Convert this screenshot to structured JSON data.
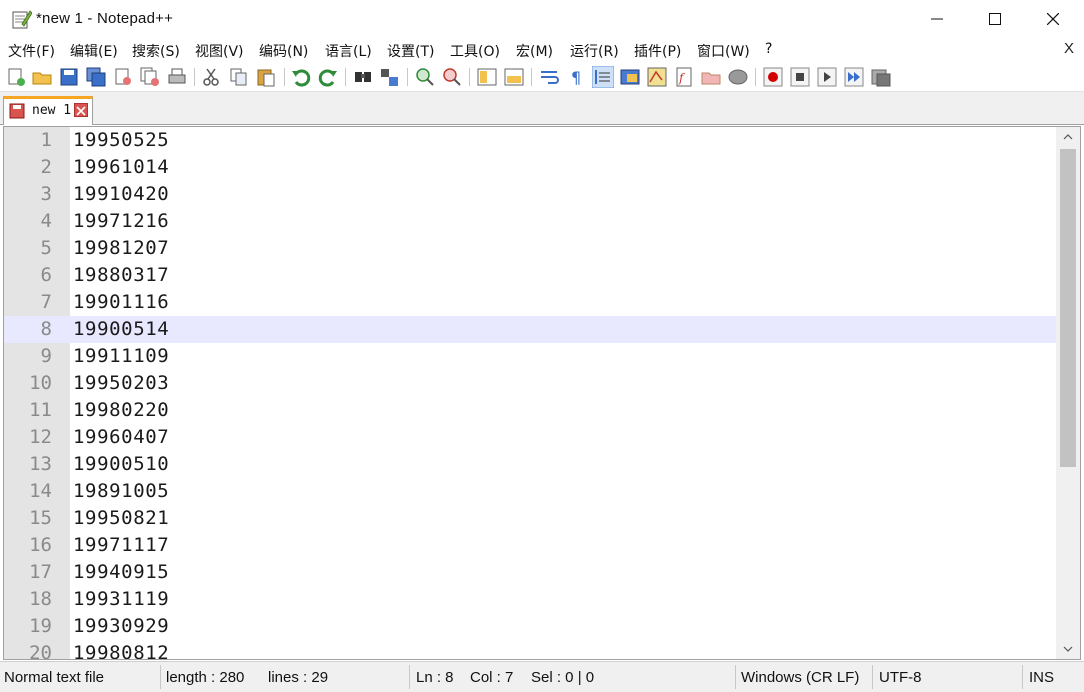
{
  "window": {
    "title": "*new 1 - Notepad++"
  },
  "menu": {
    "items": [
      "文件(F)",
      "编辑(E)",
      "搜索(S)",
      "视图(V)",
      "编码(N)",
      "语言(L)",
      "设置(T)",
      "工具(O)",
      "宏(M)",
      "运行(R)",
      "插件(P)",
      "窗口(W)",
      "?"
    ],
    "close_label": "X"
  },
  "toolbar": {
    "icons": [
      "new-file-icon",
      "open-file-icon",
      "save-icon",
      "save-all-icon",
      "close-icon",
      "close-all-icon",
      "print-icon",
      "cut-icon",
      "copy-icon",
      "paste-icon",
      "undo-icon",
      "redo-icon",
      "find-icon",
      "replace-icon",
      "zoom-in-icon",
      "zoom-out-icon",
      "sync-vertical-icon",
      "sync-horizontal-icon",
      "word-wrap-icon",
      "show-all-chars-icon",
      "indent-guide-icon",
      "user-lang-icon",
      "doc-map-icon",
      "function-list-icon",
      "folder-workspace-icon",
      "monitoring-icon",
      "record-macro-icon",
      "stop-record-icon",
      "play-macro-icon",
      "run-macro-multiple-icon",
      "save-macro-icon"
    ]
  },
  "tabs": [
    {
      "label": "new 1",
      "modified": true
    }
  ],
  "editor": {
    "current_line": 8,
    "lines": [
      {
        "num": "1",
        "text": "19950525"
      },
      {
        "num": "2",
        "text": "19961014"
      },
      {
        "num": "3",
        "text": "19910420"
      },
      {
        "num": "4",
        "text": "19971216"
      },
      {
        "num": "5",
        "text": "19981207"
      },
      {
        "num": "6",
        "text": "19880317"
      },
      {
        "num": "7",
        "text": "19901116"
      },
      {
        "num": "8",
        "text": "19900514"
      },
      {
        "num": "9",
        "text": "19911109"
      },
      {
        "num": "10",
        "text": "19950203"
      },
      {
        "num": "11",
        "text": "19980220"
      },
      {
        "num": "12",
        "text": "19960407"
      },
      {
        "num": "13",
        "text": "19900510"
      },
      {
        "num": "14",
        "text": "19891005"
      },
      {
        "num": "15",
        "text": "19950821"
      },
      {
        "num": "16",
        "text": "19971117"
      },
      {
        "num": "17",
        "text": "19940915"
      },
      {
        "num": "18",
        "text": "19931119"
      },
      {
        "num": "19",
        "text": "19930929"
      },
      {
        "num": "20",
        "text": "19980812"
      }
    ]
  },
  "status": {
    "file_type": "Normal text file",
    "length": "length : 280",
    "lines": "lines : 29",
    "ln": "Ln : 8",
    "col": "Col : 7",
    "sel": "Sel : 0 | 0",
    "eol": "Windows (CR LF)",
    "encoding": "UTF-8",
    "mode": "INS"
  },
  "colors": {
    "tab_accent": "#f5a623",
    "current_line": "#e8e8ff",
    "gutter": "#e4e4e4"
  }
}
